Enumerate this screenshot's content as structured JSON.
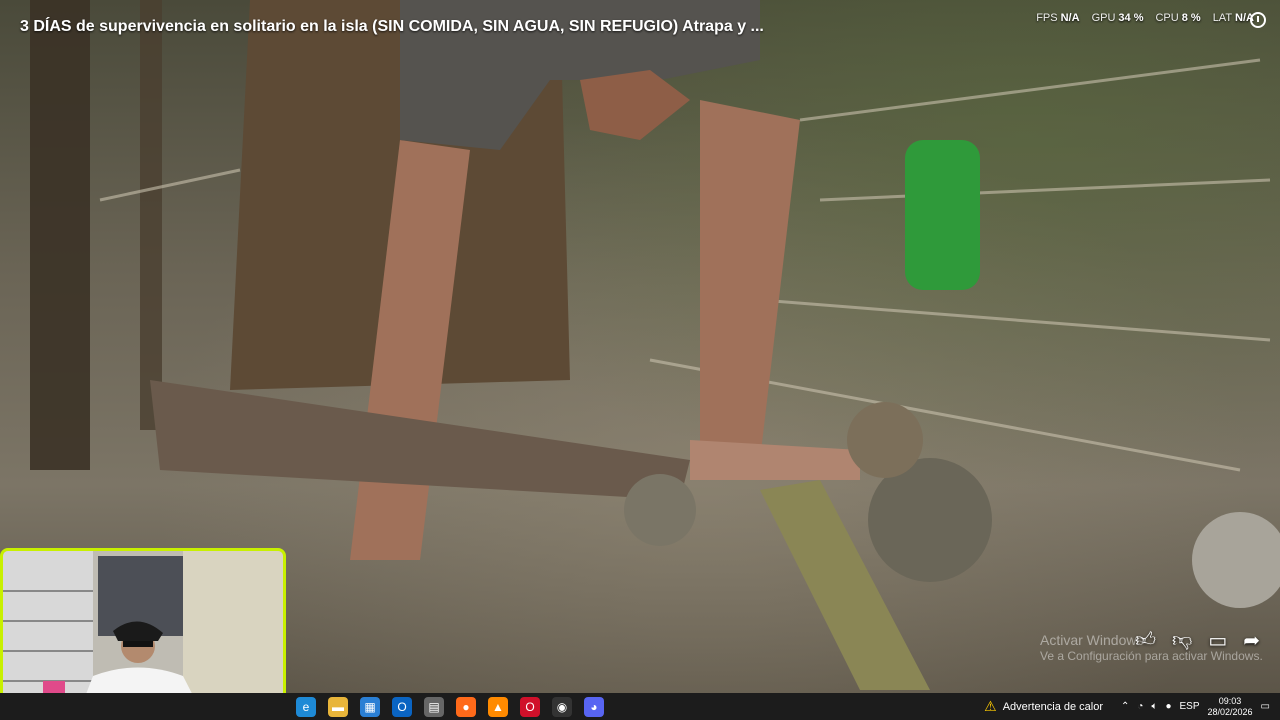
{
  "video": {
    "title": "3 DÍAS de supervivencia en solitario en la isla (SIN COMIDA, SIN AGUA, SIN REFUGIO) Atrapa y ...",
    "actions": {
      "like_icon": "like-icon",
      "dislike_icon": "dislike-icon",
      "comment_icon": "comment-icon",
      "share_icon": "share-icon"
    }
  },
  "overlay": {
    "fps_label": "FPS",
    "fps_value": "N/A",
    "gpu_label": "GPU",
    "gpu_value": "34 %",
    "cpu_label": "CPU",
    "cpu_value": "8 %",
    "lat_label": "LAT",
    "lat_value": "N/A"
  },
  "watermark": {
    "line1": "Activar Windows",
    "line2": "Ve a Configuración para activar Windows."
  },
  "taskbar": {
    "apps": [
      {
        "name": "edge-icon",
        "glyph": "e",
        "color": "#1e8ad6"
      },
      {
        "name": "file-explorer-icon",
        "glyph": "▬",
        "color": "#e8b53a"
      },
      {
        "name": "store-icon",
        "glyph": "▦",
        "color": "#2a7fd4"
      },
      {
        "name": "outlook-icon",
        "glyph": "O",
        "color": "#0a64c2"
      },
      {
        "name": "app-icon",
        "glyph": "▤",
        "color": "#666666"
      },
      {
        "name": "firefox-icon",
        "glyph": "●",
        "color": "#ff6a1a"
      },
      {
        "name": "vlc-icon",
        "glyph": "▲",
        "color": "#ff8a00"
      },
      {
        "name": "opera-icon",
        "glyph": "O",
        "color": "#d0102a"
      },
      {
        "name": "obs-icon",
        "glyph": "◉",
        "color": "#333333"
      },
      {
        "name": "discord-icon",
        "glyph": "◕",
        "color": "#5865f2"
      }
    ],
    "warning_text": "Advertencia de calor",
    "language": "ESP",
    "time": "09:03",
    "date": "28/02/2026"
  },
  "colors": {
    "webcam_border": "#c8f000",
    "taskbar": "#1c1c1c"
  }
}
